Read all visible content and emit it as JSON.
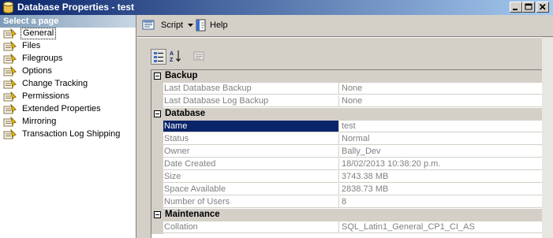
{
  "window": {
    "title": "Database Properties - test"
  },
  "sidebar": {
    "header": "Select a page",
    "items": [
      {
        "label": "General",
        "active": true
      },
      {
        "label": "Files"
      },
      {
        "label": "Filegroups"
      },
      {
        "label": "Options"
      },
      {
        "label": "Change Tracking"
      },
      {
        "label": "Permissions"
      },
      {
        "label": "Extended Properties"
      },
      {
        "label": "Mirroring"
      },
      {
        "label": "Transaction Log Shipping"
      }
    ]
  },
  "toolbar": {
    "script_label": "Script",
    "help_label": "Help"
  },
  "grid": {
    "categories": [
      {
        "name": "Backup",
        "properties": [
          {
            "name": "Last Database Backup",
            "value": "None"
          },
          {
            "name": "Last Database Log Backup",
            "value": "None"
          }
        ]
      },
      {
        "name": "Database",
        "properties": [
          {
            "name": "Name",
            "value": "test",
            "selected": true
          },
          {
            "name": "Status",
            "value": "Normal"
          },
          {
            "name": "Owner",
            "value": "Bally_Dev"
          },
          {
            "name": "Date Created",
            "value": "18/02/2013 10:38:20 p.m."
          },
          {
            "name": "Size",
            "value": "3743.38 MB"
          },
          {
            "name": "Space Available",
            "value": "2838.73 MB"
          },
          {
            "name": "Number of Users",
            "value": "8"
          }
        ]
      },
      {
        "name": "Maintenance",
        "properties": [
          {
            "name": "Collation",
            "value": "SQL_Latin1_General_CP1_CI_AS"
          }
        ]
      }
    ]
  },
  "colors": {
    "title_start": "#0a246a",
    "title_end": "#a6caf0",
    "selection": "#0a246a",
    "face": "#d4d0c8"
  }
}
